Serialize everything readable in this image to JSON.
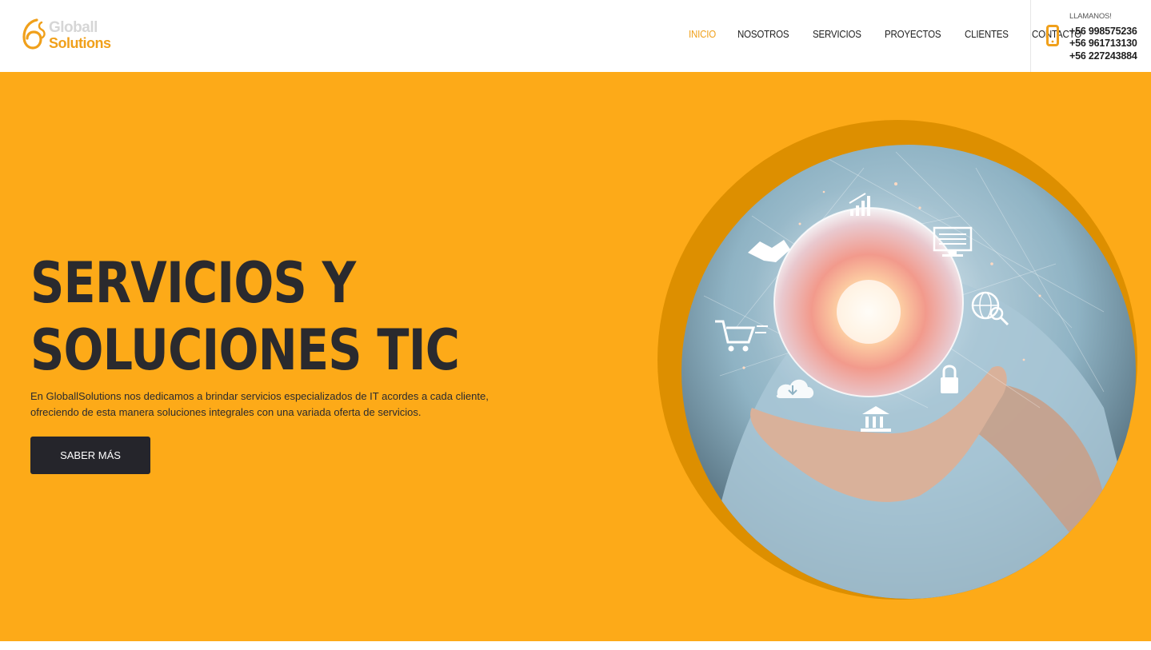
{
  "brand": {
    "line1": "Globall",
    "line2": "Solutions",
    "accent_color": "#f0a01b",
    "hero_bg": "#fdaa18",
    "dark": "#25252b"
  },
  "nav": {
    "items": [
      {
        "label": "INICIO",
        "active": true
      },
      {
        "label": "NOSOTROS",
        "active": false
      },
      {
        "label": "SERVICIOS",
        "active": false
      },
      {
        "label": "PROYECTOS",
        "active": false
      },
      {
        "label": "CLIENTES",
        "active": false
      },
      {
        "label": "CONTACTO",
        "active": false
      }
    ]
  },
  "call": {
    "label": "LLAMANOS!",
    "icon": "smartphone-icon",
    "phones": [
      "+56 998575236",
      "+56 961713130",
      "+56 227243884"
    ]
  },
  "hero": {
    "title_line1": "SERVICIOS Y",
    "title_line2": "SOLUCIONES TIC",
    "description": "En GloballSolutions nos dedicamos a brindar servicios especializados de IT acordes a cada cliente, ofreciendo de esta manera soluciones integrales con una variada oferta de servicios.",
    "button_label": "SABER MÁS",
    "image_icons": [
      "growth-chart-icon",
      "handshake-icon",
      "monitor-icon",
      "shopping-cart-icon",
      "globe-search-icon",
      "cloud-download-icon",
      "lock-icon",
      "bank-icon"
    ]
  }
}
